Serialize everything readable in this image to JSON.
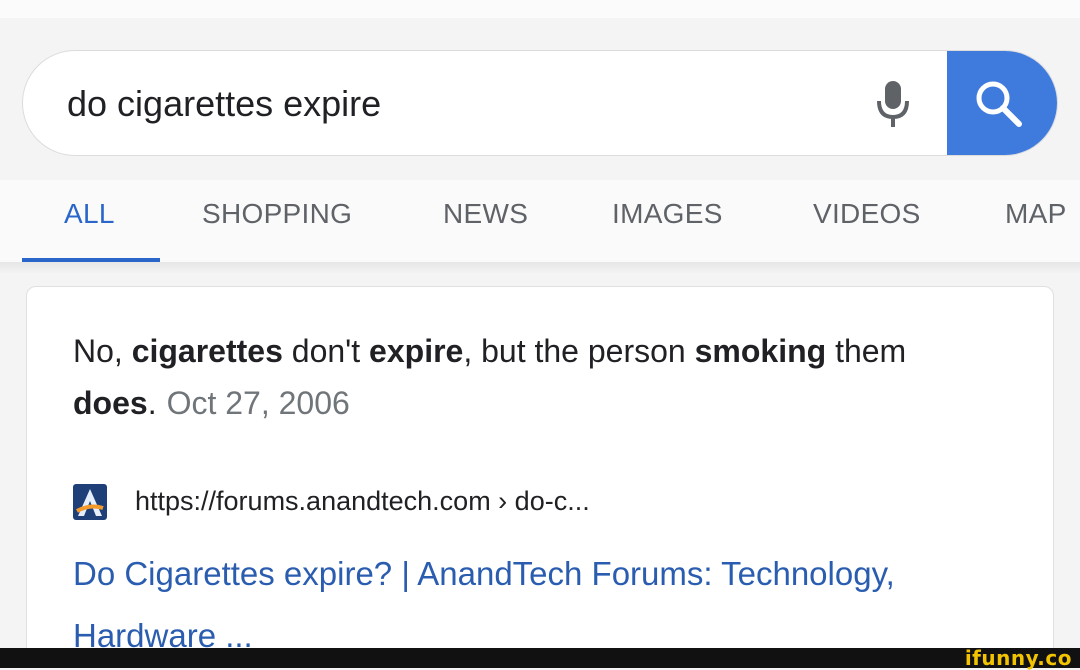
{
  "search": {
    "query": "do cigarettes expire"
  },
  "tabs": [
    {
      "label": "ALL",
      "active": true
    },
    {
      "label": "SHOPPING",
      "active": false
    },
    {
      "label": "NEWS",
      "active": false
    },
    {
      "label": "IMAGES",
      "active": false
    },
    {
      "label": "VIDEOS",
      "active": false
    },
    {
      "label": "MAP",
      "active": false
    }
  ],
  "result": {
    "snippet_parts": {
      "p1": "No, ",
      "b1": "cigarettes",
      "p2": " don't ",
      "b2": "expire",
      "p3": ", but the person ",
      "b3": "smoking",
      "p4": " them ",
      "b4": "does",
      "p5": "."
    },
    "date": "Oct 27, 2006",
    "source_url": "https://forums.anandtech.com › do-c...",
    "title": "Do Cigarettes expire? | AnandTech Forums: Technology, Hardware ..."
  },
  "watermark": "ifunny.co",
  "colors": {
    "accent_blue": "#3f7bdc",
    "link_blue": "#2a5db0",
    "active_tab": "#2a66c9",
    "watermark_yellow": "#f2c300"
  },
  "icons": [
    "microphone-icon",
    "search-icon",
    "anandtech-favicon"
  ]
}
